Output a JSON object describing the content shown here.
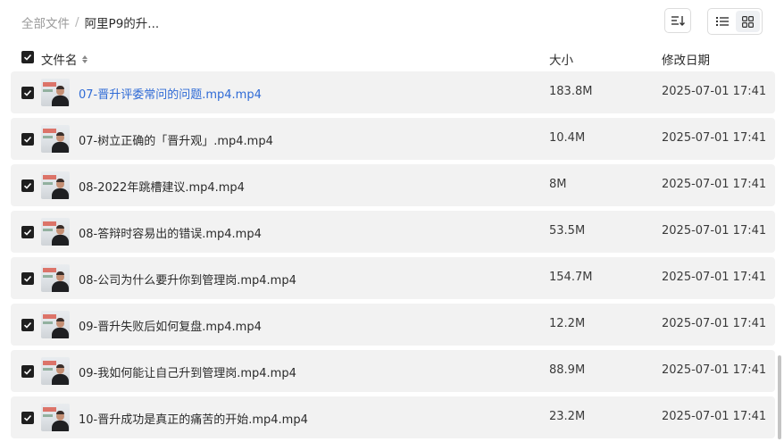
{
  "breadcrumb": {
    "root": "全部文件",
    "separator": "/",
    "current": "阿里P9的升..."
  },
  "toolbar": {
    "sort_icon": "sort-lines-icon",
    "list_view_icon": "list-view-icon",
    "grid_view_icon": "grid-view-icon",
    "active_view": "list"
  },
  "columns": {
    "name": "文件名",
    "size": "大小",
    "modified": "修改日期"
  },
  "files": [
    {
      "name": "07-晋升评委常问的问题.mp4.mp4",
      "size": "183.8M",
      "modified": "2025-07-01 17:41",
      "checked": true,
      "highlighted": true
    },
    {
      "name": "07-树立正确的「晋升观」.mp4.mp4",
      "size": "10.4M",
      "modified": "2025-07-01 17:41",
      "checked": true
    },
    {
      "name": "08-2022年跳槽建议.mp4.mp4",
      "size": "8M",
      "modified": "2025-07-01 17:41",
      "checked": true
    },
    {
      "name": "08-答辩时容易出的错误.mp4.mp4",
      "size": "53.5M",
      "modified": "2025-07-01 17:41",
      "checked": true
    },
    {
      "name": "08-公司为什么要升你到管理岗.mp4.mp4",
      "size": "154.7M",
      "modified": "2025-07-01 17:41",
      "checked": true
    },
    {
      "name": "09-晋升失败后如何复盘.mp4.mp4",
      "size": "12.2M",
      "modified": "2025-07-01 17:41",
      "checked": true
    },
    {
      "name": "09-我如何能让自己升到管理岗.mp4.mp4",
      "size": "88.9M",
      "modified": "2025-07-01 17:41",
      "checked": true
    },
    {
      "name": "10-晋升成功是真正的痛苦的开始.mp4.mp4",
      "size": "23.2M",
      "modified": "2025-07-01 17:41",
      "checked": true
    }
  ],
  "colors": {
    "link": "#2f6bd6",
    "row_bg": "#f2f2f2",
    "checkbox": "#1f1f1f"
  }
}
